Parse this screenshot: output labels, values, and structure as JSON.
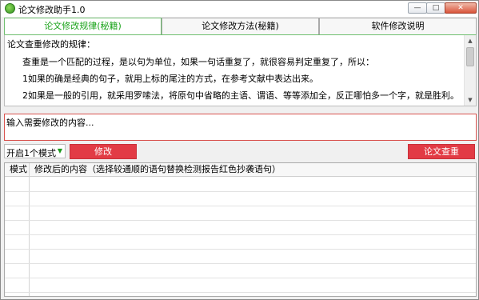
{
  "window": {
    "title": "论文修改助手1.0",
    "controls": {
      "minimize": "—",
      "maximize": "□",
      "close": "✕"
    }
  },
  "tabs": [
    {
      "label": "论文修改规律(秘籍)",
      "active": true
    },
    {
      "label": "论文修改方法(秘籍)",
      "active": false
    },
    {
      "label": "软件修改说明",
      "active": false
    }
  ],
  "info": {
    "lines": [
      "论文查重修改的规律：",
      "查重是一个匹配的过程，是以句为单位，如果一句话重复了，就很容易判定重复了，所以：",
      "1如果的确是经典的句子，就用上标的尾注的方式，在参考文献中表达出来。",
      "2如果是一般的引用，就采用罗嗦法，将原句中省略的主语、谓语、等等添加全，反正哪怕多一个字，就是胜利。"
    ]
  },
  "input": {
    "placeholder": "输入需要修改的内容..."
  },
  "controls": {
    "mode_select": "开启1个模式",
    "modify_button": "修改",
    "check_button": "论文查重"
  },
  "table": {
    "headers": [
      "模式",
      "修改后的内容（选择较通顺的语句替换检测报告红色抄袭语句）"
    ],
    "rows": []
  },
  "colors": {
    "accent_green": "#1aa31a",
    "button_red": "#e23b45",
    "input_border_red": "#d9534f"
  }
}
